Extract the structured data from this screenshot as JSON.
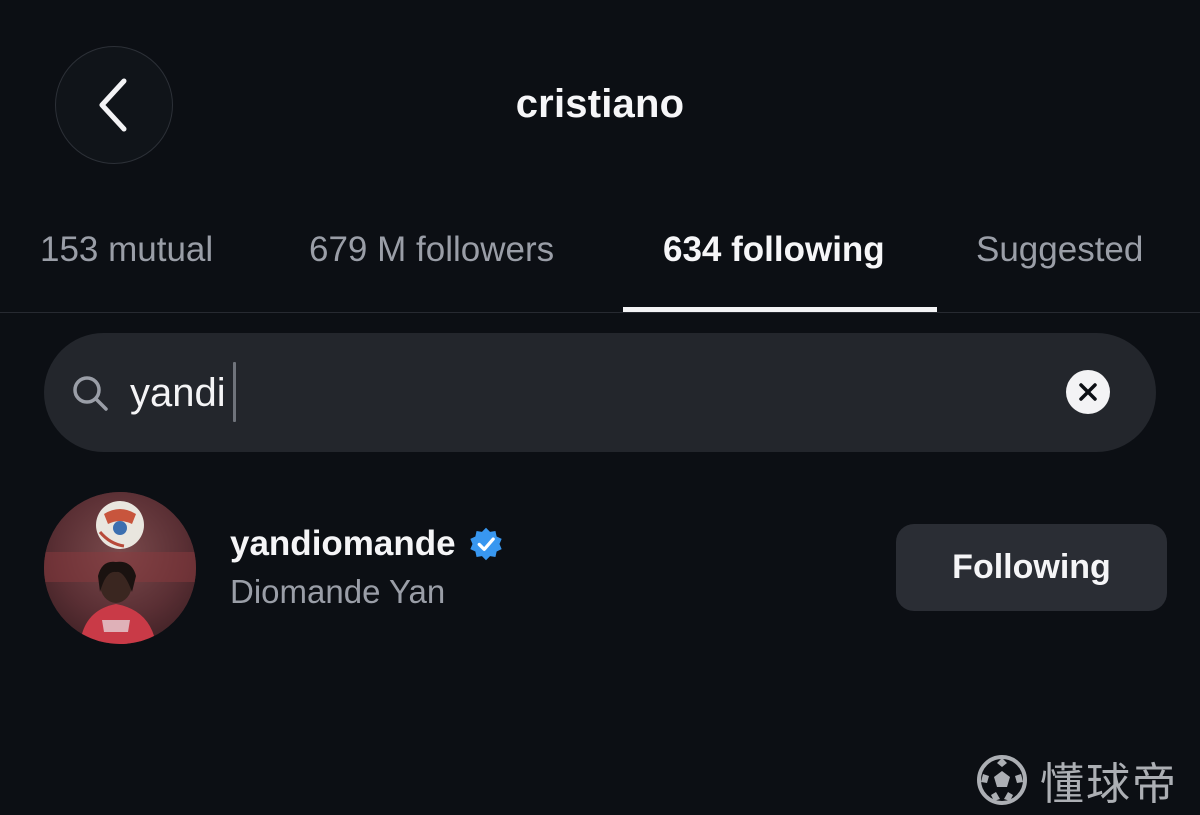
{
  "header": {
    "title": "cristiano",
    "back_icon": "chevron-left-icon"
  },
  "tabs": [
    {
      "label": "153 mutual",
      "active": false
    },
    {
      "label": "679 M followers",
      "active": false
    },
    {
      "label": "634 following",
      "active": true
    },
    {
      "label": "Suggested",
      "active": false
    }
  ],
  "search": {
    "value": "yandi",
    "icon": "search-icon",
    "clear_icon": "clear-icon"
  },
  "results": [
    {
      "username": "yandiomande",
      "full_name": "Diomande Yan",
      "verified": true,
      "button_label": "Following"
    }
  ],
  "watermark": {
    "text": "懂球帝"
  },
  "colors": {
    "background": "#0c0f14",
    "search_background": "#23262c",
    "button_background": "#2a2d34",
    "verified_blue": "#3897f0",
    "muted_text": "#9a9ea7",
    "primary_text": "#f5f5f7"
  }
}
